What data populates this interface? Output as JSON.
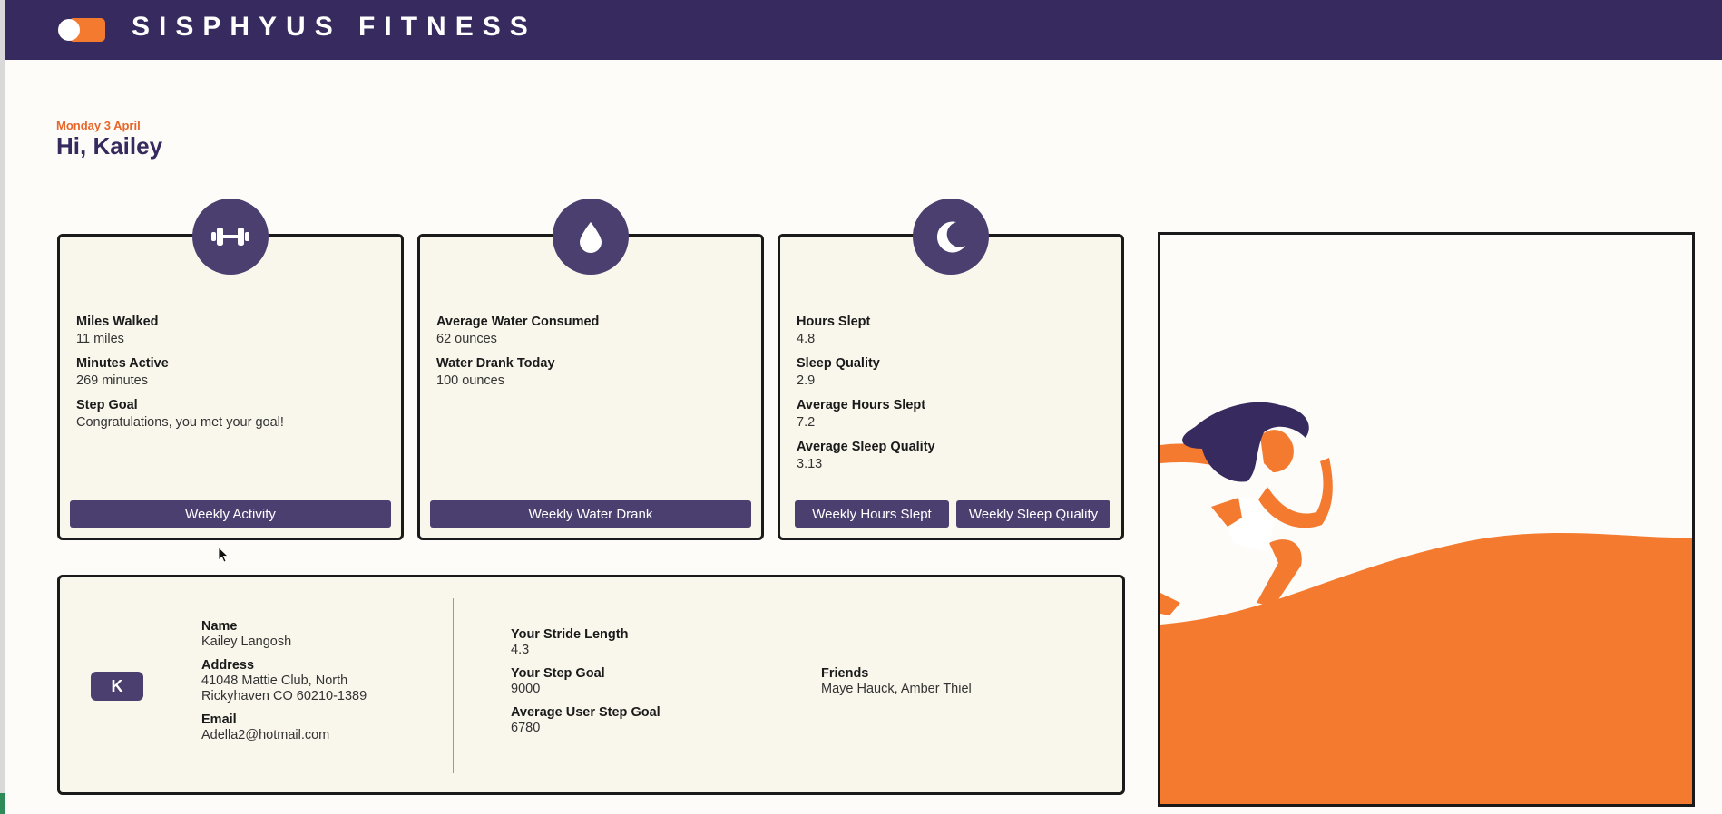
{
  "header": {
    "brand": "SISPHYUS FITNESS",
    "logo_icon": "logo-pill-icon"
  },
  "greeting": {
    "date": "Monday 3 April",
    "text": "Hi, Kailey"
  },
  "colors": {
    "primary": "#372a5e",
    "accent": "#f47a30",
    "card_bg": "#f9f6ec"
  },
  "activity": {
    "icon": "dumbbell-icon",
    "stats": [
      {
        "label": "Miles Walked",
        "value": "11 miles"
      },
      {
        "label": "Minutes Active",
        "value": "269 minutes"
      },
      {
        "label": "Step Goal",
        "value": "Congratulations, you met your goal!"
      }
    ],
    "button": "Weekly Activity"
  },
  "water": {
    "icon": "water-drop-icon",
    "stats": [
      {
        "label": "Average Water Consumed",
        "value": "62 ounces"
      },
      {
        "label": "Water Drank Today",
        "value": "100 ounces"
      }
    ],
    "button": "Weekly Water Drank"
  },
  "sleep": {
    "icon": "moon-icon",
    "stats": [
      {
        "label": "Hours Slept",
        "value": "4.8"
      },
      {
        "label": "Sleep Quality",
        "value": "2.9"
      },
      {
        "label": "Average Hours Slept",
        "value": "7.2"
      },
      {
        "label": "Average Sleep Quality",
        "value": "3.13"
      }
    ],
    "buttons": [
      "Weekly Hours Slept",
      "Weekly Sleep Quality"
    ]
  },
  "profile": {
    "avatar_initial": "K",
    "name": {
      "label": "Name",
      "value": "Kailey Langosh"
    },
    "address": {
      "label": "Address",
      "line1": "41048 Mattie Club, North",
      "line2": "Rickyhaven CO 60210-1389"
    },
    "email": {
      "label": "Email",
      "value": "Adella2@hotmail.com"
    },
    "stride": {
      "label": "Your Stride Length",
      "value": "4.3"
    },
    "step_goal": {
      "label": "Your Step Goal",
      "value": "9000"
    },
    "avg_step_goal": {
      "label": "Average User Step Goal",
      "value": "6780"
    },
    "friends": {
      "label": "Friends",
      "value": "Maye Hauck, Amber Thiel"
    }
  },
  "illustration": {
    "icon": "runner-illustration"
  }
}
